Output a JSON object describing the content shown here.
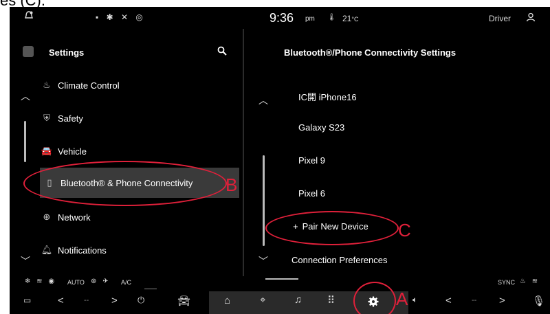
{
  "top_fragment": "es (C).",
  "status_bar": {
    "time": "9:36",
    "ampm": "pm",
    "temp": "21",
    "temp_unit": "°C",
    "driver_label": "Driver"
  },
  "left_panel": {
    "title": "Settings",
    "items": [
      {
        "label": "Climate Control",
        "icon": "climate-icon"
      },
      {
        "label": "Safety",
        "icon": "safety-icon"
      },
      {
        "label": "Vehicle",
        "icon": "vehicle-icon"
      },
      {
        "label": "Bluetooth® & Phone Connectivity",
        "icon": "phone-bluetooth-icon",
        "selected": true
      },
      {
        "label": "Network",
        "icon": "globe-icon"
      },
      {
        "label": "Notifications",
        "icon": "bell-icon"
      }
    ]
  },
  "right_panel": {
    "title": "Bluetooth®/Phone Connectivity Settings",
    "devices": [
      "IC開 iPhone16",
      "Galaxy S23",
      "Pixel 9",
      "Pixel 6"
    ],
    "pair_new_label": "Pair New Device",
    "pair_new_prefix": "+",
    "connection_pref_label": "Connection Preferences"
  },
  "climate_bar": {
    "auto_label": "AUTO",
    "ac_label": "A/C",
    "sync_label": "SYNC"
  },
  "bottom_bar": {
    "left_temp_placeholder": "--",
    "right_temp_placeholder": "--"
  },
  "annotations": {
    "a": "A",
    "b": "B",
    "c": "C"
  },
  "colors": {
    "annotation": "#e0203a",
    "background": "#000000",
    "selected_row": "#3a3a3a"
  }
}
